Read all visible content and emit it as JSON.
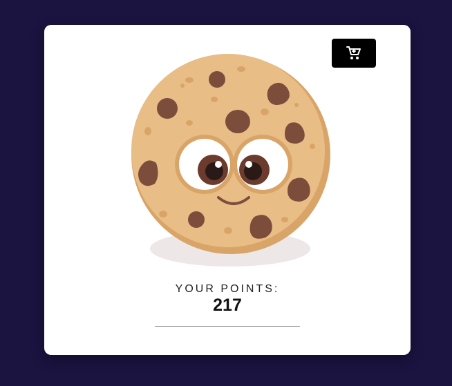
{
  "colors": {
    "background": "#1b1340",
    "card": "#ffffff",
    "cart_button": "#000000",
    "cookie_dough": "#e9bd86",
    "cookie_shade": "#d9a468",
    "chocolate_chip": "#7d4d3b"
  },
  "cart": {
    "icon": "shopping-cart-icon"
  },
  "cookie": {
    "icon": "cookie-character-image"
  },
  "points": {
    "label": "YOUR  POINTS:",
    "value": "217"
  }
}
